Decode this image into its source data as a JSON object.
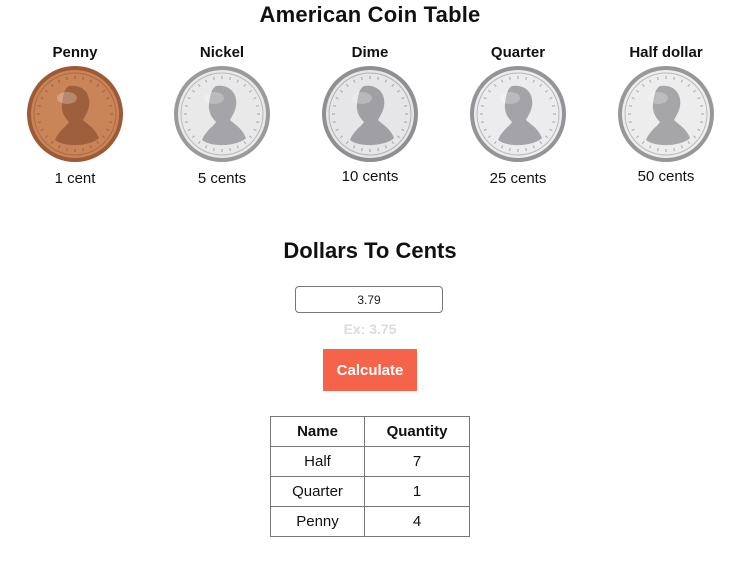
{
  "header": {
    "title": "American Coin Table"
  },
  "coins": [
    {
      "name": "Penny",
      "value": "1 cent",
      "icon": "penny-coin-icon",
      "face": "#c98458",
      "edge": "#9c5a36",
      "mark": "#7a4327"
    },
    {
      "name": "Nickel",
      "value": "5 cents",
      "icon": "nickel-coin-icon",
      "face": "#e9e9ea",
      "edge": "#9a9a9d",
      "mark": "#6e6e72"
    },
    {
      "name": "Dime",
      "value": "10 cents",
      "icon": "dime-coin-icon",
      "face": "#e6e6e8",
      "edge": "#8f8f93",
      "mark": "#66666b"
    },
    {
      "name": "Quarter",
      "value": "25 cents",
      "icon": "quarter-coin-icon",
      "face": "#ececee",
      "edge": "#949498",
      "mark": "#6a6a6f"
    },
    {
      "name": "Half dollar",
      "value": "50 cents",
      "icon": "half-dollar-coin-icon",
      "face": "#ededee",
      "edge": "#979799",
      "mark": "#6c6c70"
    }
  ],
  "converter": {
    "title": "Dollars To Cents",
    "input_value": "3.79",
    "example": "Ex: 3.75",
    "button_label": "Calculate"
  },
  "result_table": {
    "headers": [
      "Name",
      "Quantity"
    ],
    "rows": [
      {
        "name": "Half",
        "quantity": "7"
      },
      {
        "name": "Quarter",
        "quantity": "1"
      },
      {
        "name": "Penny",
        "quantity": "4"
      }
    ]
  },
  "colors": {
    "accent": "#f4634a",
    "hint": "#dcdcdc"
  }
}
